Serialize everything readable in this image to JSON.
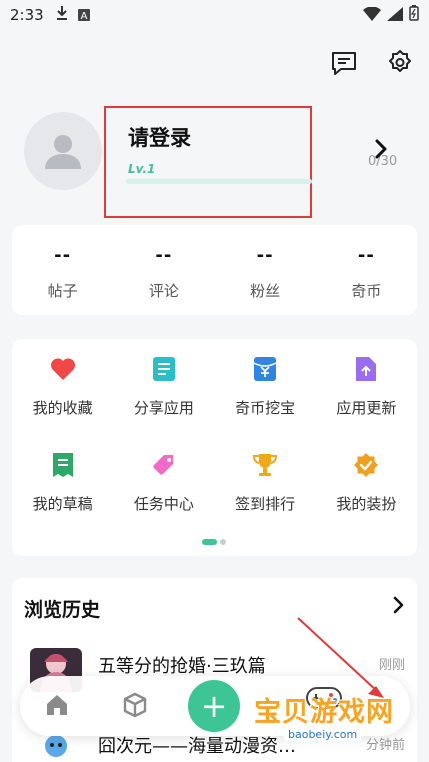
{
  "status_bar": {
    "time": "2:33"
  },
  "profile": {
    "login_prompt": "请登录",
    "level": "Lv.1",
    "level_progress_text": "0/30",
    "level_progress": 0
  },
  "stats": [
    {
      "value": "--",
      "label": "帖子"
    },
    {
      "value": "--",
      "label": "评论"
    },
    {
      "value": "--",
      "label": "粉丝"
    },
    {
      "value": "--",
      "label": "奇币"
    }
  ],
  "features": [
    {
      "label": "我的收藏",
      "icon": "heart-icon"
    },
    {
      "label": "分享应用",
      "icon": "share-doc-icon"
    },
    {
      "label": "奇币挖宝",
      "icon": "coin-envelope-icon"
    },
    {
      "label": "应用更新",
      "icon": "update-file-icon"
    },
    {
      "label": "我的草稿",
      "icon": "draft-icon"
    },
    {
      "label": "任务中心",
      "icon": "tag-icon"
    },
    {
      "label": "签到排行",
      "icon": "trophy-icon"
    },
    {
      "label": "我的装扮",
      "icon": "badge-icon"
    }
  ],
  "history": {
    "title": "浏览历史",
    "items": [
      {
        "name": "五等分的抢婚·三玖篇",
        "time": "刚刚"
      },
      {
        "name": "囧次元——海量动漫资…",
        "time": "分钟前"
      }
    ]
  },
  "bottom_nav": {
    "add_label": "+"
  },
  "watermark": {
    "main": "宝贝游戏网",
    "sub": "baobeiy.com"
  },
  "colors": {
    "accent": "#3ec596",
    "highlight_box": "#e23a3a",
    "annotation_arrow": "#e23a3a"
  }
}
